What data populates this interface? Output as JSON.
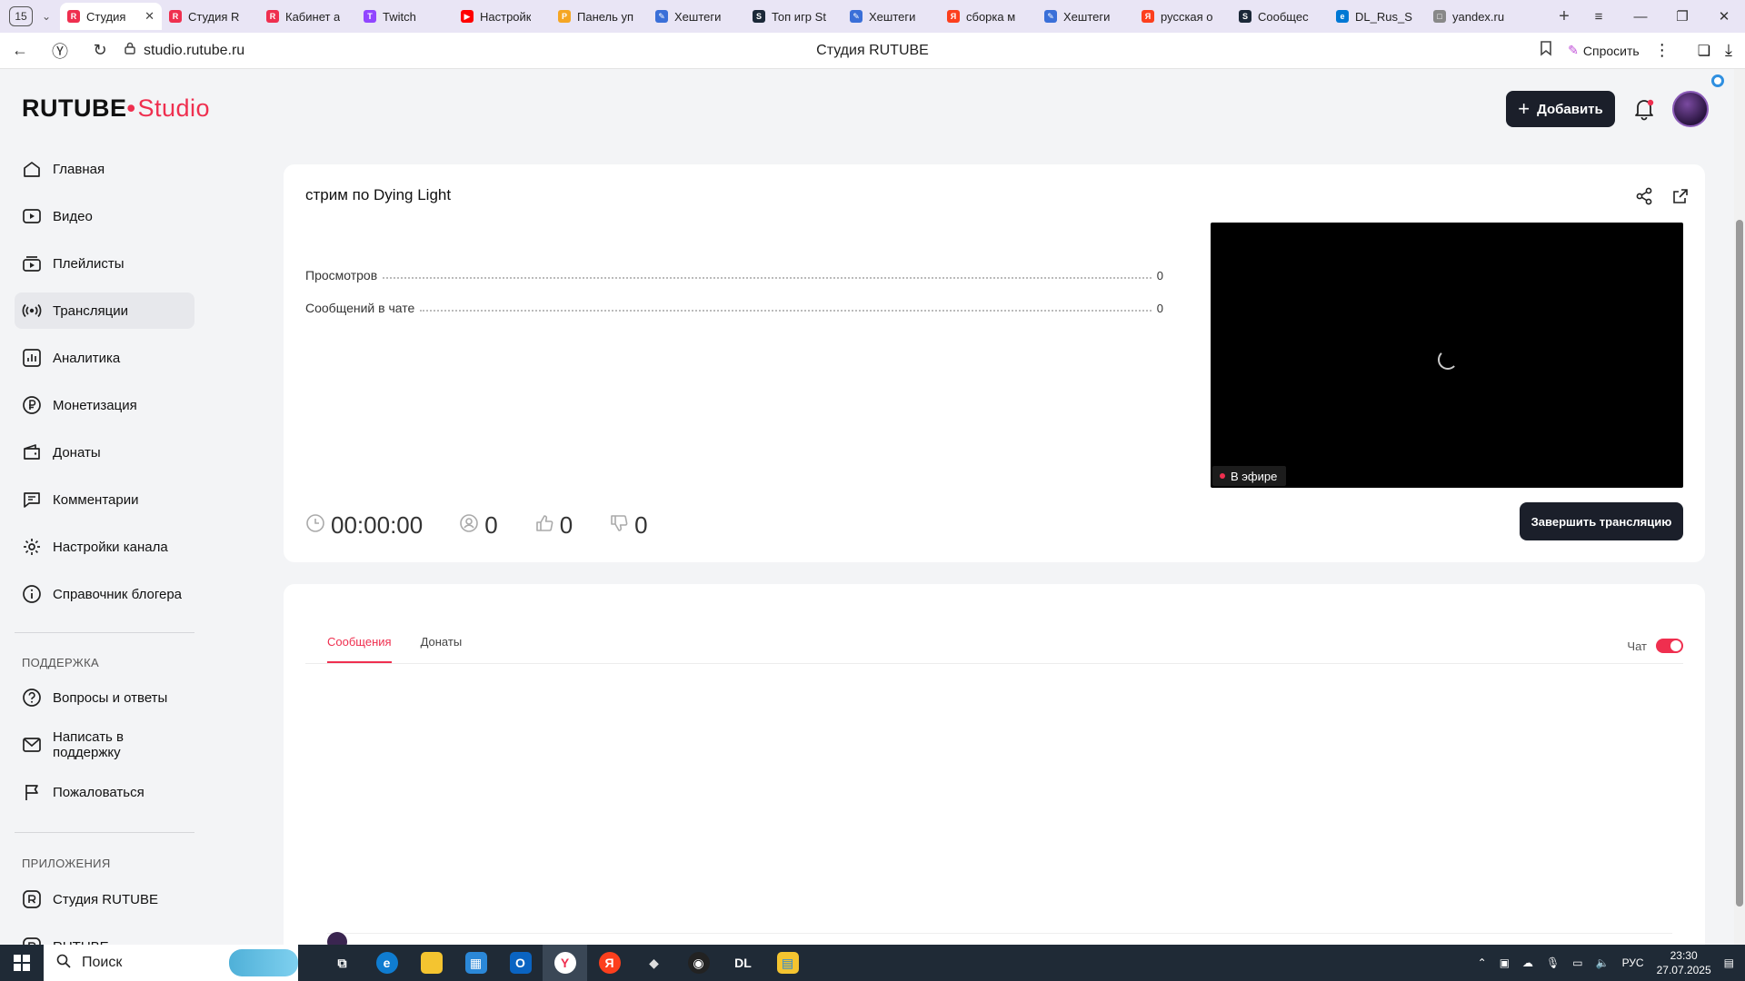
{
  "browser": {
    "tab_count": "15",
    "tabs": [
      {
        "label": "Студия",
        "color": "#ef2f4f",
        "glyph": "R",
        "active": true
      },
      {
        "label": "Студия R",
        "color": "#ef2f4f",
        "glyph": "R"
      },
      {
        "label": "Кабинет а",
        "color": "#ef2f4f",
        "glyph": "R"
      },
      {
        "label": "Twitch",
        "color": "#9146ff",
        "glyph": "T"
      },
      {
        "label": "Настройк",
        "color": "#ff0000",
        "glyph": "▶"
      },
      {
        "label": "Панель уп",
        "color": "#f5a623",
        "glyph": "P"
      },
      {
        "label": "Хештеги",
        "color": "#3a6fd8",
        "glyph": "✎"
      },
      {
        "label": "Топ игр St",
        "color": "#1b2838",
        "glyph": "S"
      },
      {
        "label": "Хештеги",
        "color": "#3a6fd8",
        "glyph": "✎"
      },
      {
        "label": "сборка м",
        "color": "#fc3f1d",
        "glyph": "Я"
      },
      {
        "label": "Хештеги",
        "color": "#3a6fd8",
        "glyph": "✎"
      },
      {
        "label": "русская о",
        "color": "#fc3f1d",
        "glyph": "Я"
      },
      {
        "label": "Сообщес",
        "color": "#1b2838",
        "glyph": "S"
      },
      {
        "label": "DL_Rus_S",
        "color": "#0078d4",
        "glyph": "e"
      },
      {
        "label": "yandex.ru",
        "color": "#888888",
        "glyph": "□"
      }
    ],
    "url": "studio.rutube.ru",
    "page_title": "Студия RUTUBE",
    "ask_label": "Спросить"
  },
  "header": {
    "logo_main": "RUTUBE",
    "logo_studio": "Studio",
    "add_label": "Добавить"
  },
  "sidebar": {
    "main_items": [
      {
        "label": "Главная",
        "icon": "home-icon"
      },
      {
        "label": "Видео",
        "icon": "video-icon"
      },
      {
        "label": "Плейлисты",
        "icon": "playlist-icon"
      },
      {
        "label": "Трансляции",
        "icon": "broadcast-icon",
        "active": true
      },
      {
        "label": "Аналитика",
        "icon": "analytics-icon"
      },
      {
        "label": "Монетизация",
        "icon": "ruble-icon"
      },
      {
        "label": "Донаты",
        "icon": "wallet-icon"
      },
      {
        "label": "Комментарии",
        "icon": "comment-icon"
      },
      {
        "label": "Настройки канала",
        "icon": "gear-icon"
      },
      {
        "label": "Справочник блогера",
        "icon": "info-icon"
      }
    ],
    "support_label": "ПОДДЕРЖКА",
    "support_items": [
      {
        "label": "Вопросы и ответы",
        "icon": "question-icon"
      },
      {
        "label": "Написать в поддержку",
        "icon": "mail-icon"
      },
      {
        "label": "Пожаловаться",
        "icon": "flag-icon"
      }
    ],
    "apps_label": "ПРИЛОЖЕНИЯ",
    "apps_items": [
      {
        "label": "Студия RUTUBE",
        "icon": "rutube-app-icon"
      },
      {
        "label": "RUTUBE",
        "icon": "rutube-app-icon"
      }
    ]
  },
  "stream": {
    "title": "стрим по Dying Light",
    "stats": [
      {
        "label": "Просмотров",
        "value": "0"
      },
      {
        "label": "Сообщений в чате",
        "value": "0"
      }
    ],
    "duration": "00:00:00",
    "viewers": "0",
    "likes": "0",
    "dislikes": "0",
    "live_label": "В эфире",
    "end_label": "Завершить трансляцию"
  },
  "chat": {
    "tabs": [
      "Сообщения",
      "Донаты"
    ],
    "toggle_label": "Чат",
    "toggle_on": true
  },
  "taskbar": {
    "search_placeholder": "Поиск",
    "lang": "РУС",
    "time": "23:30",
    "date": "27.07.2025"
  },
  "colors": {
    "accent": "#ef2f4f",
    "dark_button": "#1b1f2a",
    "page_bg": "#f3f4f6"
  }
}
